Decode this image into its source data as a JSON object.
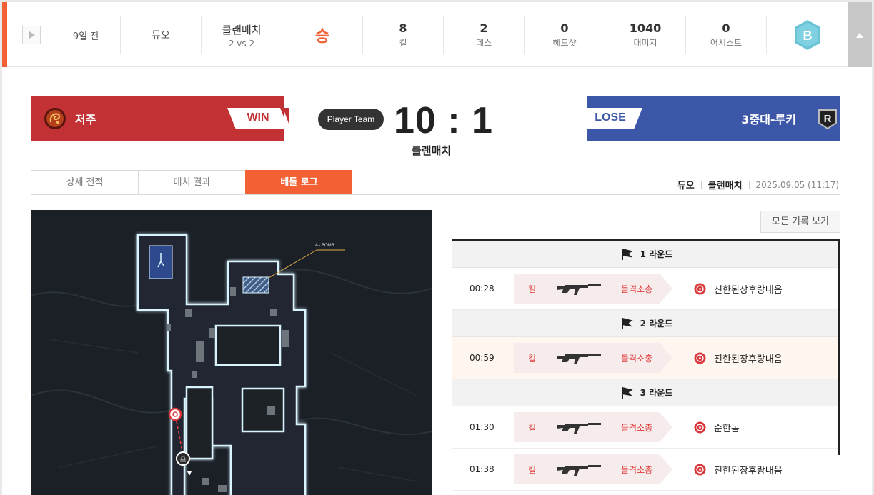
{
  "summary": {
    "time_ago": "9일 전",
    "mode": "듀오",
    "match_type": "클랜매치",
    "match_format": "2 vs 2",
    "result": "승",
    "stats": [
      {
        "value": "8",
        "label": "킬"
      },
      {
        "value": "2",
        "label": "데스"
      },
      {
        "value": "0",
        "label": "헤드샷"
      },
      {
        "value": "1040",
        "label": "대미지"
      },
      {
        "value": "0",
        "label": "어시스트"
      }
    ],
    "rank_badge": "B"
  },
  "scoreboard": {
    "team_a": {
      "name": "저주",
      "result": "WIN"
    },
    "team_b": {
      "name": "3중대-루키",
      "result": "LOSE"
    },
    "player_team_label": "Player Team",
    "score": "10 : 1",
    "match_type": "클랜매치"
  },
  "tabs": [
    {
      "label": "상세 전적",
      "active": false
    },
    {
      "label": "매치 결과",
      "active": false
    },
    {
      "label": "베틀 로그",
      "active": true
    }
  ],
  "meta": {
    "mode": "듀오",
    "type": "클랜매치",
    "date": "2025.09.05 (11:17)"
  },
  "map": {
    "bomb_label": "A - BOMB"
  },
  "log": {
    "view_all_label": "모든 기록 보기",
    "rounds": [
      {
        "label": "1 라운드",
        "kills": [
          {
            "time": "00:28",
            "action": "킬",
            "weapon": "돌격소총",
            "victim": "진한된장후랑내음",
            "highlight": false
          }
        ]
      },
      {
        "label": "2 라운드",
        "kills": [
          {
            "time": "00:59",
            "action": "킬",
            "weapon": "돌격소총",
            "victim": "진한된장후랑내음",
            "highlight": true
          }
        ]
      },
      {
        "label": "3 라운드",
        "kills": [
          {
            "time": "01:30",
            "action": "킬",
            "weapon": "돌격소총",
            "victim": "순한놈",
            "highlight": false
          },
          {
            "time": "01:38",
            "action": "킬",
            "weapon": "돌격소총",
            "victim": "진한된장후랑내음",
            "highlight": false
          }
        ]
      }
    ]
  },
  "colors": {
    "accent": "#f26033",
    "team_red": "#c23133",
    "team_blue": "#3d57a8",
    "rank_badge": "#6cc3d5"
  }
}
